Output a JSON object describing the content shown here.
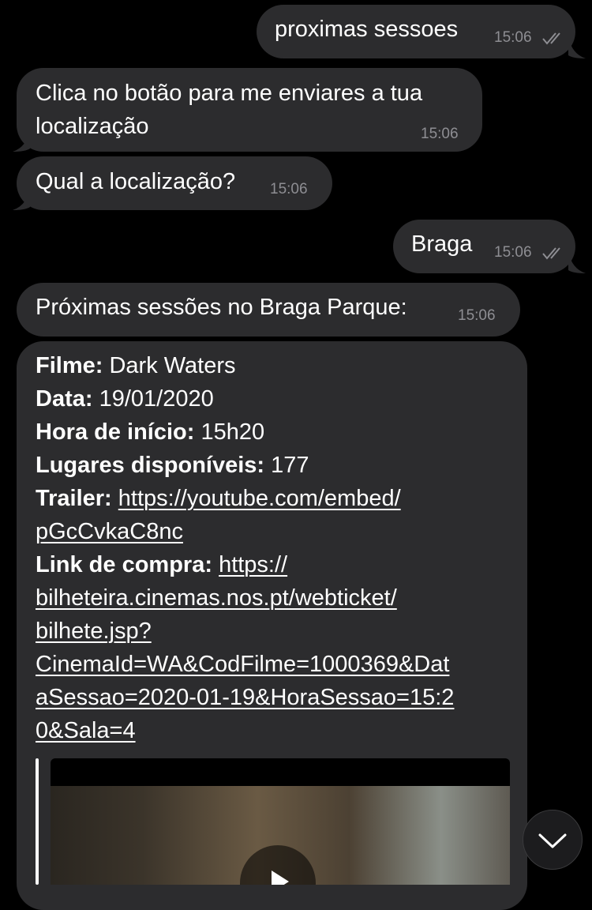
{
  "messages": [
    {
      "text": "proximas sessoes",
      "time": "15:06",
      "direction": "outgoing",
      "read": true
    },
    {
      "lines": [
        "Clica no botão para me enviares a tua",
        "localização"
      ],
      "time": "15:06",
      "direction": "incoming"
    },
    {
      "text": "Qual a localização?",
      "time": "15:06",
      "direction": "incoming"
    },
    {
      "text": "Braga",
      "time": "15:06",
      "direction": "outgoing",
      "read": true
    },
    {
      "text": "Próximas sessões no Braga Parque:",
      "time": "15:06",
      "direction": "incoming"
    }
  ],
  "session": {
    "film_label": "Filme:",
    "film_value": "Dark Waters",
    "date_label": "Data:",
    "date_value": "19/01/2020",
    "start_label": "Hora de início:",
    "start_value": "15h20",
    "seats_label": "Lugares disponíveis:",
    "seats_value": "177",
    "trailer_label": "Trailer:",
    "trailer_url_lines": [
      "https://youtube.com/embed/",
      "pGcCvkaC8nc"
    ],
    "buy_label": "Link de compra:",
    "buy_url_lines": [
      "https://",
      "bilheteira.cinemas.nos.pt/webticket/",
      "bilhete.jsp?",
      "CinemaId=WA&CodFilme=1000369&Dat",
      "aSessao=2020-01-19&HoraSessao=15:2",
      "0&Sala=4"
    ]
  },
  "icons": {
    "read_receipt": "double-check-icon",
    "scroll_down": "chevron-down-icon",
    "play": "play-icon"
  },
  "colors": {
    "background": "#000000",
    "bubble": "#2c2c2e",
    "text": "#ffffff",
    "meta": "#8e8e93"
  }
}
